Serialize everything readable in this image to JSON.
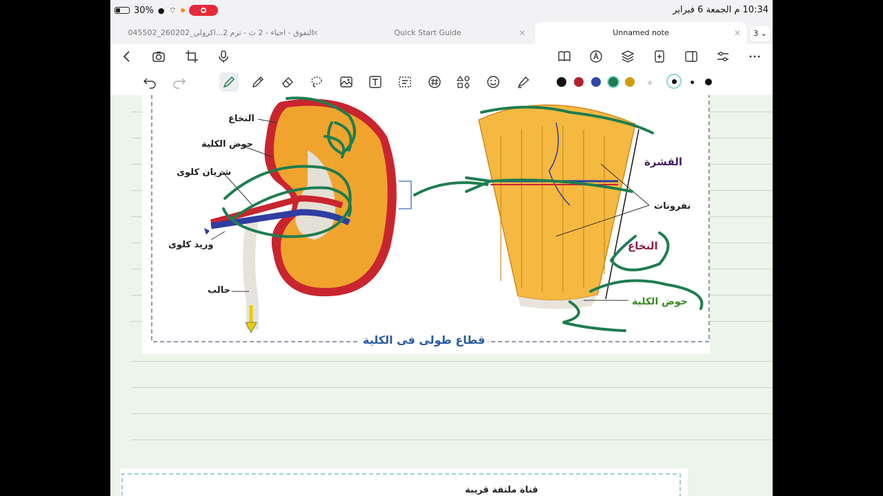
{
  "status_bar": {
    "battery": "30%",
    "time_date": "10:34 م  الجمعة 6 فبراير"
  },
  "tabs": [
    {
      "label": "التفوق - احياء - 2 ث - ترم 2...اكرولي_260202_045502"
    },
    {
      "label": "Quick Start Guide"
    },
    {
      "label": "Unnamed note"
    }
  ],
  "tab_count": "3",
  "toolbar": {
    "icons_top": [
      "back-chevron-icon",
      "camera-icon",
      "crop-icon",
      "microphone-icon",
      "book-icon",
      "text-circle-icon",
      "layers-icon",
      "add-page-icon",
      "sidebar-icon",
      "sliders-icon",
      "more-icon"
    ],
    "tools": [
      "undo-icon",
      "redo-icon",
      "pen-icon",
      "pencil-icon",
      "eraser-icon",
      "lasso-icon",
      "image-icon",
      "text-box-icon",
      "select-icon",
      "hashtag-icon",
      "shapes-icon",
      "sticker-icon",
      "highlighter-icon"
    ],
    "colors": [
      "#111111",
      "#b0222e",
      "#2f4aa6",
      "#1e7d4f",
      "#d39a14"
    ],
    "selected_color": "#1e7d4f"
  },
  "figure": {
    "caption": "قطاع طولى فى الكلية",
    "labels": {
      "medulla_left": "النخاع",
      "pelvis_left": "حوض الكلية",
      "artery": "شريان كلوى",
      "vein": "وريد كلوى",
      "ureter": "حالب",
      "cortex": "القشرة",
      "nephrons": "نفرونات",
      "medulla_right": "النخاع",
      "pelvis_right": "حوض الكلية"
    }
  },
  "figure2": {
    "title": "قناة ملتفة قريبة"
  }
}
